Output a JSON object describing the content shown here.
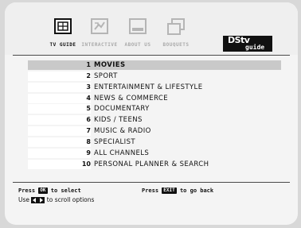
{
  "tabs": [
    {
      "label": "TV GUIDE",
      "icon": "tv-guide-icon",
      "active": true
    },
    {
      "label": "INTERACTIVE",
      "icon": "interactive-icon",
      "active": false
    },
    {
      "label": "ABOUT US",
      "icon": "about-us-icon",
      "active": false
    },
    {
      "label": "BOUQUETS",
      "icon": "bouquets-icon",
      "active": false
    }
  ],
  "logo": {
    "line1": "DStv",
    "line2": "guide"
  },
  "menu": {
    "selected_index": 0,
    "items": [
      {
        "num": "1",
        "label": "MOVIES"
      },
      {
        "num": "2",
        "label": "SPORT"
      },
      {
        "num": "3",
        "label": "ENTERTAINMENT & LIFESTYLE"
      },
      {
        "num": "4",
        "label": "NEWS & COMMERCE"
      },
      {
        "num": "5",
        "label": "DOCUMENTARY"
      },
      {
        "num": "6",
        "label": "KIDS / TEENS"
      },
      {
        "num": "7",
        "label": "MUSIC & RADIO"
      },
      {
        "num": "8",
        "label": "SPECIALIST"
      },
      {
        "num": "9",
        "label": "ALL CHANNELS"
      },
      {
        "num": "10",
        "label": "PERSONAL PLANNER & SEARCH"
      }
    ]
  },
  "footer": {
    "select_pre": "Press",
    "select_key": "OK",
    "select_post": "to select",
    "back_pre": "Press",
    "back_key": "EXIT",
    "back_post": "to go back",
    "scroll_pre": "Use",
    "scroll_post": "to scroll options"
  },
  "colors": {
    "selected_row": "#c9c9c9",
    "screen_bg": "#f4f4f4",
    "logo_bg": "#111111"
  }
}
